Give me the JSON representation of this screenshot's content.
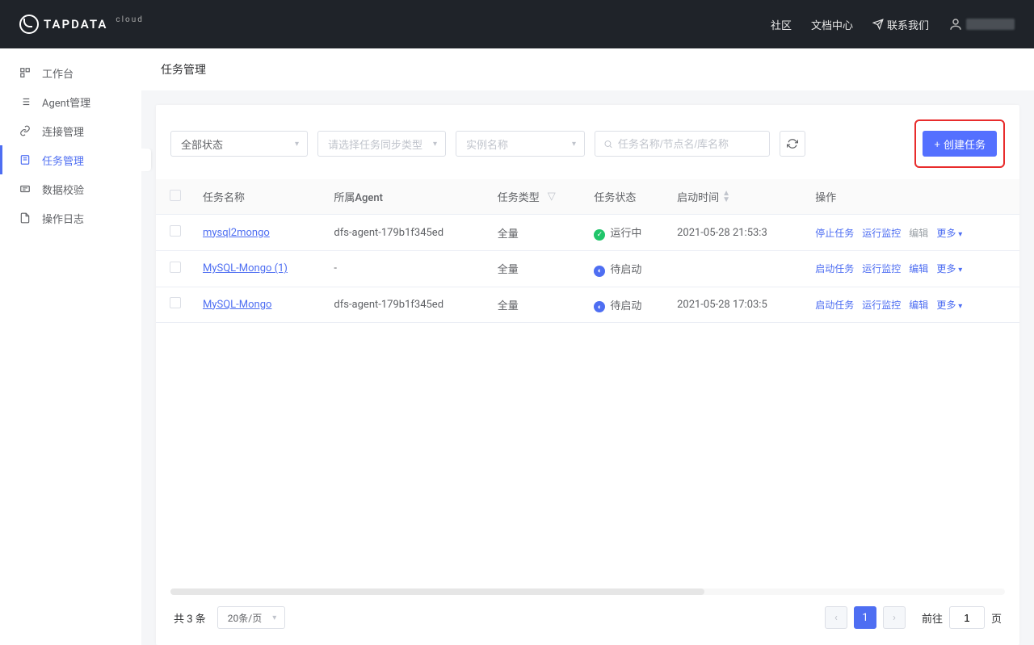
{
  "header": {
    "brand": "TAPDATA",
    "brand_sup": "cloud",
    "links": {
      "community": "社区",
      "docs": "文档中心",
      "contact": "联系我们"
    }
  },
  "sidebar": {
    "items": [
      {
        "label": "工作台",
        "icon": "dashboard-icon"
      },
      {
        "label": "Agent管理",
        "icon": "list-icon"
      },
      {
        "label": "连接管理",
        "icon": "link-icon"
      },
      {
        "label": "任务管理",
        "icon": "task-icon"
      },
      {
        "label": "数据校验",
        "icon": "verify-icon"
      },
      {
        "label": "操作日志",
        "icon": "log-icon"
      }
    ],
    "active_index": 3
  },
  "page": {
    "title": "任务管理"
  },
  "filters": {
    "status": "全部状态",
    "sync_type_placeholder": "请选择任务同步类型",
    "instance_placeholder": "实例名称",
    "search_placeholder": "任务名称/节点名/库名称",
    "create_btn": "创建任务"
  },
  "table": {
    "headers": {
      "name": "任务名称",
      "agent": "所属Agent",
      "type": "任务类型",
      "status": "任务状态",
      "start_time": "启动时间",
      "ops": "操作"
    },
    "rows": [
      {
        "name": "mysql2mongo",
        "agent": "dfs-agent-179b1f345ed",
        "type": "全量",
        "status_text": "运行中",
        "status_color": "green",
        "start_time": "2021-05-28 21:53:3",
        "action1": "停止任务",
        "action2": "运行监控",
        "action3": "编辑",
        "action3_gray": true,
        "more": "更多"
      },
      {
        "name": "MySQL-Mongo (1)",
        "agent": "-",
        "type": "全量",
        "status_text": "待启动",
        "status_color": "blue",
        "start_time": "",
        "action1": "启动任务",
        "action2": "运行监控",
        "action3": "编辑",
        "action3_gray": false,
        "more": "更多"
      },
      {
        "name": "MySQL-Mongo",
        "agent": "dfs-agent-179b1f345ed",
        "type": "全量",
        "status_text": "待启动",
        "status_color": "blue",
        "start_time": "2021-05-28 17:03:5",
        "action1": "启动任务",
        "action2": "运行监控",
        "action3": "编辑",
        "action3_gray": false,
        "more": "更多"
      }
    ]
  },
  "pager": {
    "total_text": "共 3 条",
    "page_size": "20条/页",
    "current": "1",
    "goto_prefix": "前往",
    "goto_suffix": "页",
    "goto_value": "1"
  }
}
